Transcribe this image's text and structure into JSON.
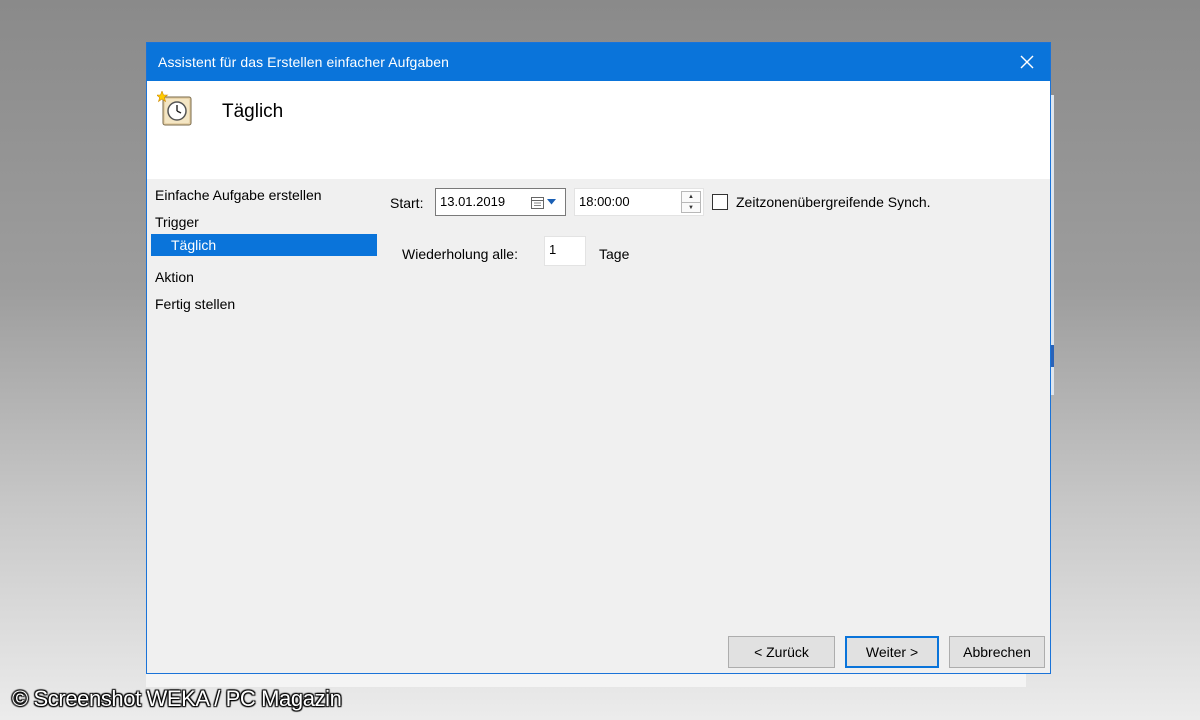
{
  "window": {
    "title": "Assistent für das Erstellen einfacher Aufgaben",
    "close_icon": "close-icon"
  },
  "header": {
    "icon": "scheduled-task-clock-icon",
    "title": "Täglich"
  },
  "steps": [
    {
      "label": "Einfache Aufgabe erstellen",
      "active": false
    },
    {
      "label": "Trigger",
      "active": false
    },
    {
      "label": "Täglich",
      "active": true
    },
    {
      "label": "Aktion",
      "active": false
    },
    {
      "label": "Fertig stellen",
      "active": false
    }
  ],
  "form": {
    "start_label": "Start:",
    "start_date": "13.01.2019",
    "start_time": "18:00:00",
    "sync_label": "Zeitzonenübergreifende Synch.",
    "sync_checked": false,
    "repeat_label": "Wiederholung alle:",
    "repeat_value": "1",
    "repeat_unit": "Tage"
  },
  "buttons": {
    "back": "< Zurück",
    "next": "Weiter >",
    "cancel": "Abbrechen"
  },
  "watermark": "© Screenshot WEKA / PC Magazin",
  "colors": {
    "accent": "#0a74da"
  }
}
